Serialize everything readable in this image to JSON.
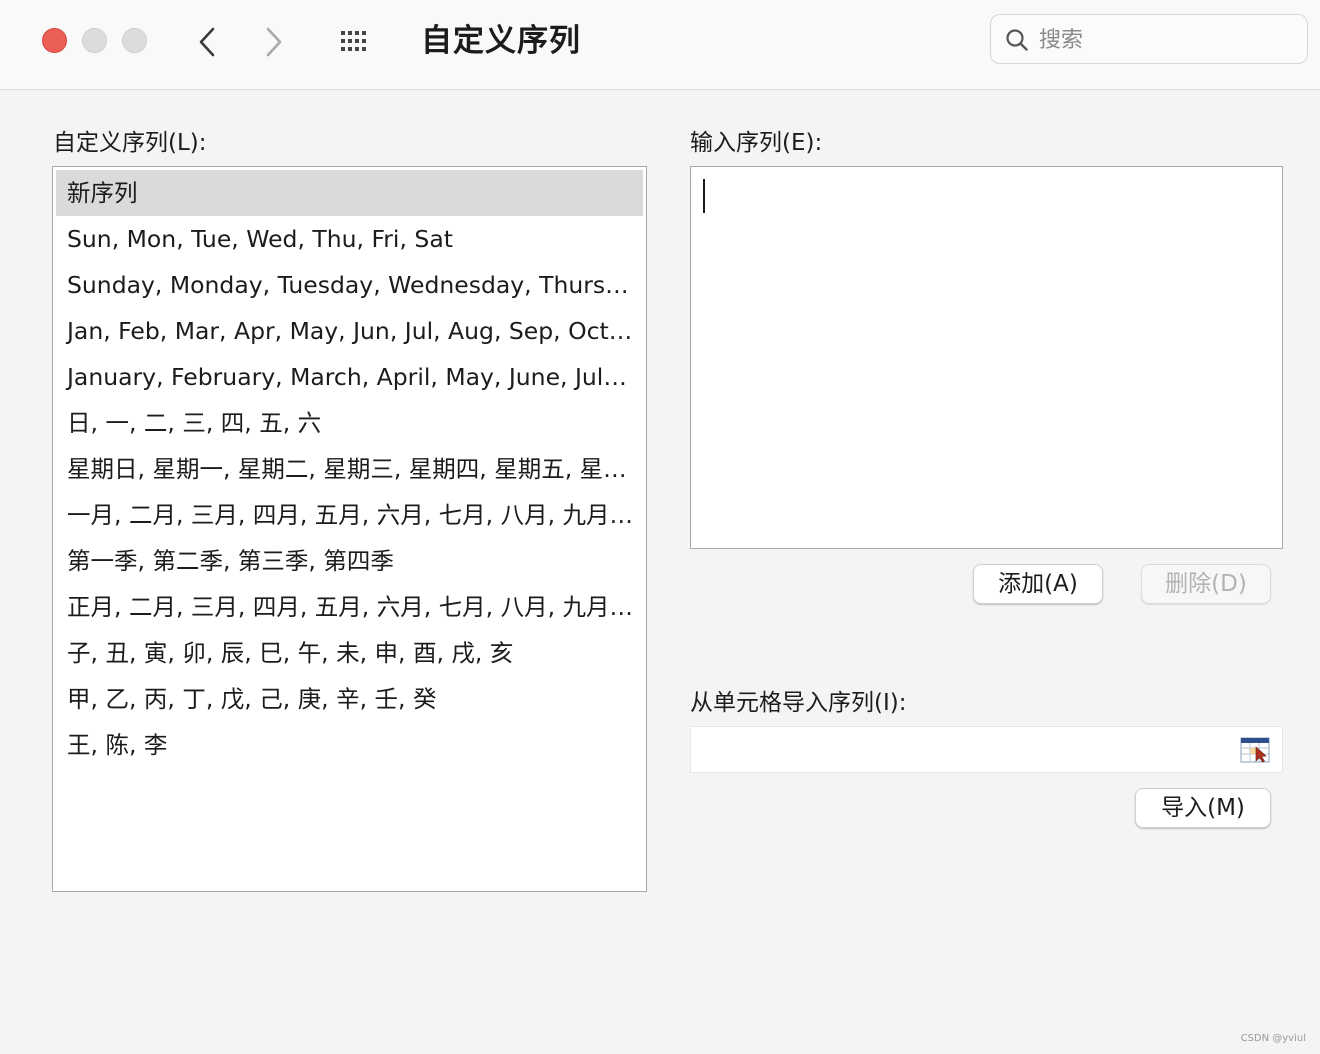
{
  "window": {
    "title": "自定义序列"
  },
  "toolbar": {
    "back_icon": "chevron-left-icon",
    "forward_icon": "chevron-right-icon",
    "grid_icon": "grid-icon"
  },
  "search": {
    "placeholder": "搜索",
    "value": ""
  },
  "custom_lists": {
    "label": "自定义序列(L):",
    "items": [
      "新序列",
      "Sun, Mon, Tue, Wed, Thu, Fri, Sat",
      "Sunday, Monday, Tuesday, Wednesday, Thursday, Friday, Saturday",
      "Jan, Feb, Mar, Apr, May, Jun, Jul, Aug, Sep, Oct, Nov, Dec",
      "January, February, March, April, May, June, July, August, September, October, November, December",
      "日, 一, 二, 三, 四, 五, 六",
      "星期日, 星期一, 星期二, 星期三, 星期四, 星期五, 星期六",
      "一月, 二月, 三月, 四月, 五月, 六月, 七月, 八月, 九月, 十月, 十一月, 十二月",
      "第一季, 第二季, 第三季, 第四季",
      "正月, 二月, 三月, 四月, 五月, 六月, 七月, 八月, 九月, 十月, 十一月, 腊月",
      "子, 丑, 寅, 卯, 辰, 巳, 午, 未, 申, 酉, 戌, 亥",
      "甲, 乙, 丙, 丁, 戊, 己, 庚, 辛, 壬, 癸",
      "王, 陈, 李"
    ],
    "selected_index": 0
  },
  "entry": {
    "label": "输入序列(E):",
    "value": ""
  },
  "buttons": {
    "add": "添加(A)",
    "delete": "删除(D)",
    "import": "导入(M)"
  },
  "import_from_cells": {
    "label": "从单元格导入序列(I):",
    "value": "",
    "picker_icon": "range-select-icon"
  },
  "watermark": "CSDN @yviul",
  "colors": {
    "close": "#ec5f57",
    "selection": "#dadada",
    "background": "#f4f4f4"
  }
}
